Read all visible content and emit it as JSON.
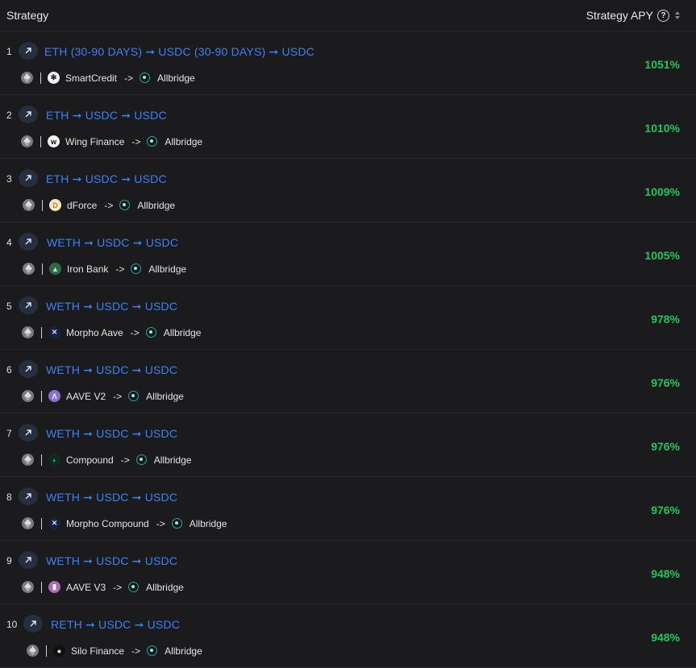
{
  "header": {
    "strategy_label": "Strategy",
    "apy_label": "Strategy APY",
    "help_glyph": "?"
  },
  "colors": {
    "route": "#3b82f6",
    "apy": "#22c55e"
  },
  "rows": [
    {
      "rank": "1",
      "route": "ETH (30-90 DAYS) ➞ USDC (30-90 DAYS) ➞ USDC",
      "protocol": "SmartCredit",
      "protocol_icon": "smartcredit-icon",
      "arrow": "->",
      "bridge": "Allbridge",
      "apy": "1051%"
    },
    {
      "rank": "2",
      "route": "ETH ➞ USDC ➞ USDC",
      "protocol": "Wing Finance",
      "protocol_icon": "wing-finance-icon",
      "arrow": "->",
      "bridge": "Allbridge",
      "apy": "1010%"
    },
    {
      "rank": "3",
      "route": "ETH ➞ USDC ➞ USDC",
      "protocol": "dForce",
      "protocol_icon": "dforce-icon",
      "arrow": "->",
      "bridge": "Allbridge",
      "apy": "1009%"
    },
    {
      "rank": "4",
      "route": "WETH ➞ USDC ➞ USDC",
      "protocol": "Iron Bank",
      "protocol_icon": "iron-bank-icon",
      "arrow": "->",
      "bridge": "Allbridge",
      "apy": "1005%"
    },
    {
      "rank": "5",
      "route": "WETH ➞ USDC ➞ USDC",
      "protocol": "Morpho Aave",
      "protocol_icon": "morpho-icon",
      "arrow": "->",
      "bridge": "Allbridge",
      "apy": "978%"
    },
    {
      "rank": "6",
      "route": "WETH ➞ USDC ➞ USDC",
      "protocol": "AAVE V2",
      "protocol_icon": "aave-icon",
      "arrow": "->",
      "bridge": "Allbridge",
      "apy": "976%"
    },
    {
      "rank": "7",
      "route": "WETH ➞ USDC ➞ USDC",
      "protocol": "Compound",
      "protocol_icon": "compound-icon",
      "arrow": "->",
      "bridge": "Allbridge",
      "apy": "976%"
    },
    {
      "rank": "8",
      "route": "WETH ➞ USDC ➞ USDC",
      "protocol": "Morpho Compound",
      "protocol_icon": "morpho-icon",
      "arrow": "->",
      "bridge": "Allbridge",
      "apy": "976%"
    },
    {
      "rank": "9",
      "route": "WETH ➞ USDC ➞ USDC",
      "protocol": "AAVE V3",
      "protocol_icon": "aave-v3-icon",
      "arrow": "->",
      "bridge": "Allbridge",
      "apy": "948%"
    },
    {
      "rank": "10",
      "route": "RETH ➞ USDC ➞ USDC",
      "protocol": "Silo Finance",
      "protocol_icon": "silo-finance-icon",
      "arrow": "->",
      "bridge": "Allbridge",
      "apy": "948%"
    }
  ]
}
